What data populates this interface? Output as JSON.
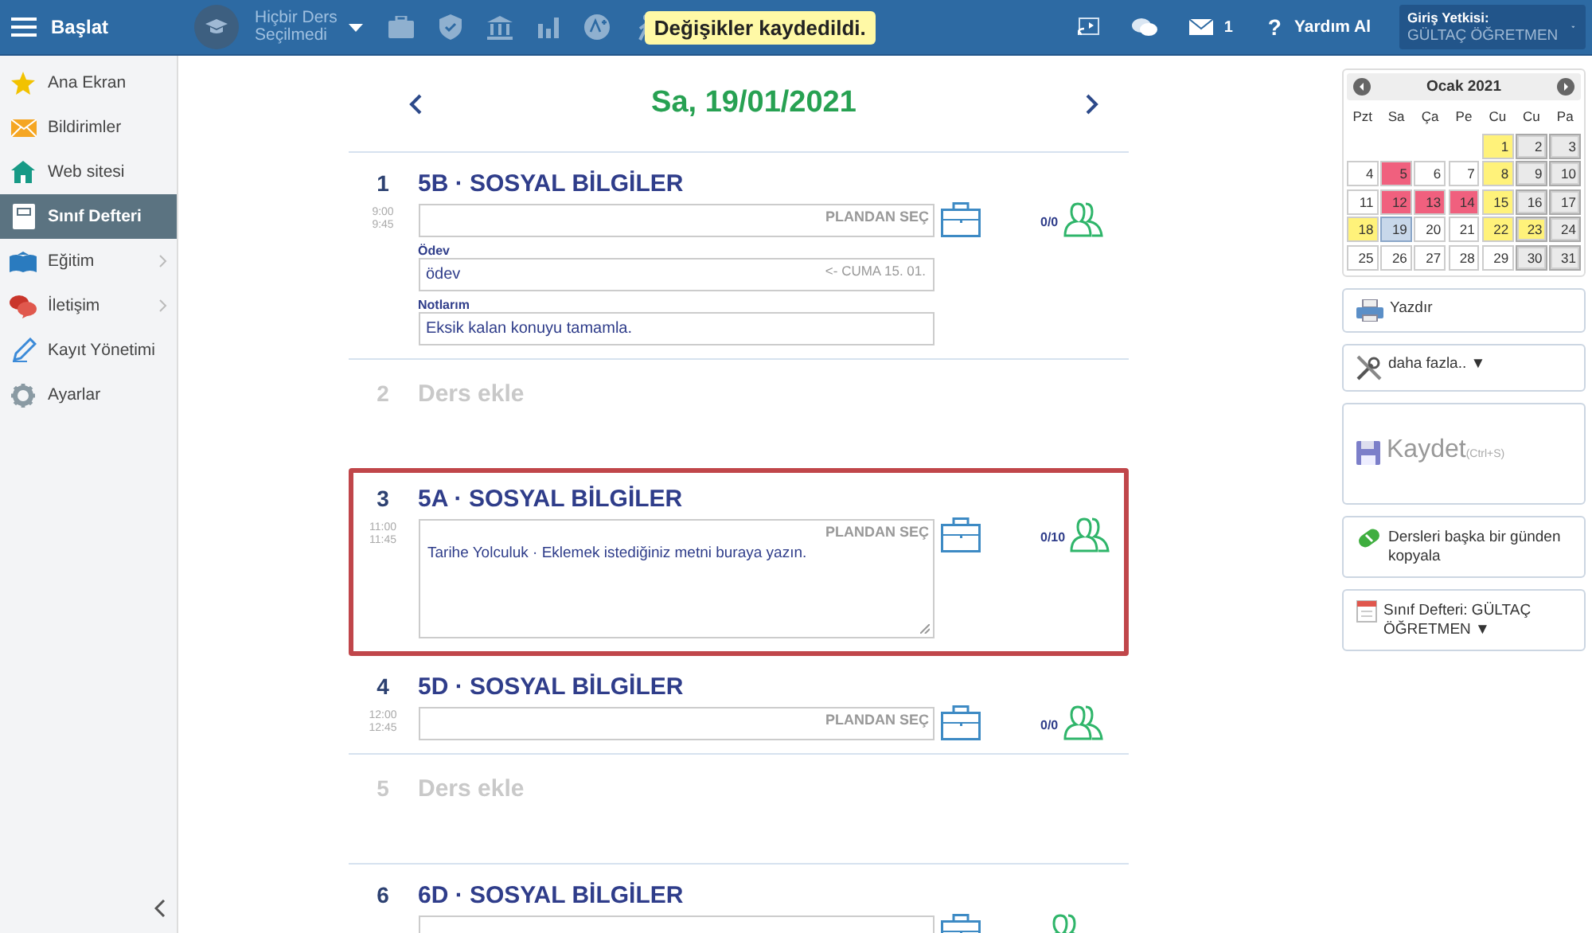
{
  "topbar": {
    "menu_label": "Başlat",
    "course_picker": {
      "line1": "Hiçbir Ders",
      "line2": "Seçilmedi"
    },
    "toast": "Değişikler kaydedildi.",
    "messages_count": "1",
    "help_mark": "?",
    "help_label": "Yardım Al",
    "login": {
      "label": "Giriş Yetkisi:",
      "value": "GÜLTAÇ ÖĞRETMEN"
    }
  },
  "sidebar": {
    "items": [
      {
        "label": "Ana Ekran",
        "kind": "star",
        "selected": false,
        "submenu": false
      },
      {
        "label": "Bildirimler",
        "kind": "mail",
        "selected": false,
        "submenu": false
      },
      {
        "label": "Web sitesi",
        "kind": "home",
        "selected": false,
        "submenu": false
      },
      {
        "label": "Sınıf Defteri",
        "kind": "notebook",
        "selected": true,
        "submenu": false
      },
      {
        "label": "Eğitim",
        "kind": "book",
        "selected": false,
        "submenu": true
      },
      {
        "label": "İletişim",
        "kind": "chat",
        "selected": false,
        "submenu": true
      },
      {
        "label": "Kayıt Yönetimi",
        "kind": "pen",
        "selected": false,
        "submenu": false
      },
      {
        "label": "Ayarlar",
        "kind": "gear",
        "selected": false,
        "submenu": false
      }
    ]
  },
  "day_header": {
    "date": "Sa, 19/01/2021"
  },
  "lessons": [
    {
      "kind": "lesson",
      "number": "1",
      "title": "5B · SOSYAL BİLGİLER",
      "times": [
        "9:00",
        "9:45"
      ],
      "plan_label": "PLANDAN SEÇ",
      "count": "0/0",
      "highlighted": false,
      "homework": {
        "label": "Ödev",
        "value": "ödev",
        "hint": "<- CUMA 15. 01."
      },
      "notes": {
        "label": "Notlarım",
        "value": "Eksik kalan konuyu tamamla."
      }
    },
    {
      "kind": "empty",
      "number": "2",
      "title": "Ders ekle"
    },
    {
      "kind": "lesson",
      "number": "3",
      "title": "5A · SOSYAL BİLGİLER",
      "times": [
        "11:00",
        "11:45"
      ],
      "plan_label": "PLANDAN SEÇ",
      "count": "0/10",
      "highlighted": true,
      "content": "Tarihe Yolculuk · Eklemek istediğiniz metni buraya yazın."
    },
    {
      "kind": "lesson",
      "number": "4",
      "title": "5D · SOSYAL BİLGİLER",
      "times": [
        "12:00",
        "12:45"
      ],
      "plan_label": "PLANDAN SEÇ",
      "count": "0/0",
      "highlighted": false
    },
    {
      "kind": "empty",
      "number": "5",
      "title": "Ders ekle"
    },
    {
      "kind": "lesson",
      "number": "6",
      "title": "6D · SOSYAL BİLGİLER",
      "highlighted": false
    }
  ],
  "calendar": {
    "title": "Ocak 2021",
    "weekdays": [
      "Pzt",
      "Sa",
      "Ça",
      "Pe",
      "Cu",
      "Cu",
      "Pa"
    ],
    "days": [
      {
        "day": "1",
        "color": "#fff27a",
        "weekend": false,
        "selected": false
      },
      {
        "day": "2",
        "weekend": true,
        "selected": false
      },
      {
        "day": "3",
        "weekend": true,
        "selected": false
      },
      {
        "day": "4",
        "weekend": false,
        "selected": false
      },
      {
        "day": "5",
        "color": "#f0607e",
        "weekend": false,
        "selected": false
      },
      {
        "day": "6",
        "weekend": false,
        "selected": false
      },
      {
        "day": "7",
        "weekend": false,
        "selected": false
      },
      {
        "day": "8",
        "color": "#fff27a",
        "weekend": false,
        "selected": false
      },
      {
        "day": "9",
        "weekend": true,
        "selected": false
      },
      {
        "day": "10",
        "weekend": true,
        "selected": false
      },
      {
        "day": "11",
        "weekend": false,
        "selected": false
      },
      {
        "day": "12",
        "color": "#f0607e",
        "weekend": false,
        "selected": false
      },
      {
        "day": "13",
        "color": "#f0607e",
        "weekend": false,
        "selected": false
      },
      {
        "day": "14",
        "color": "#f0607e",
        "weekend": false,
        "selected": false
      },
      {
        "day": "15",
        "color": "#fff27a",
        "weekend": false,
        "selected": false
      },
      {
        "day": "16",
        "weekend": true,
        "selected": false
      },
      {
        "day": "17",
        "weekend": true,
        "selected": false
      },
      {
        "day": "18",
        "color": "#fff27a",
        "weekend": false,
        "selected": false
      },
      {
        "day": "19",
        "weekend": false,
        "selected": true
      },
      {
        "day": "20",
        "weekend": false,
        "selected": false
      },
      {
        "day": "21",
        "weekend": false,
        "selected": false
      },
      {
        "day": "22",
        "color": "#fff27a",
        "weekend": false,
        "selected": false
      },
      {
        "day": "23",
        "color": "#fff27a",
        "weekend": true,
        "selected": false
      },
      {
        "day": "24",
        "weekend": true,
        "selected": false
      },
      {
        "day": "25",
        "weekend": false,
        "selected": false
      },
      {
        "day": "26",
        "weekend": false,
        "selected": false
      },
      {
        "day": "27",
        "weekend": false,
        "selected": false
      },
      {
        "day": "28",
        "weekend": false,
        "selected": false
      },
      {
        "day": "29",
        "weekend": false,
        "selected": false
      },
      {
        "day": "30",
        "weekend": true,
        "selected": false
      },
      {
        "day": "31",
        "weekend": true,
        "selected": false
      }
    ]
  },
  "actions": [
    {
      "kind": "print",
      "label": "Yazdır",
      "disabled": false
    },
    {
      "kind": "tools",
      "label": "daha fazla.. ▼",
      "disabled": false
    },
    {
      "kind": "save",
      "label": "Kaydet",
      "shortcut": "(Ctrl+S)",
      "disabled": true
    },
    {
      "kind": "copy",
      "label": "Dersleri başka bir günden kopyala",
      "disabled": false
    },
    {
      "kind": "calendar",
      "label": "Sınıf Defteri: GÜLTAÇ ÖĞRETMEN ▼",
      "disabled": false
    }
  ]
}
